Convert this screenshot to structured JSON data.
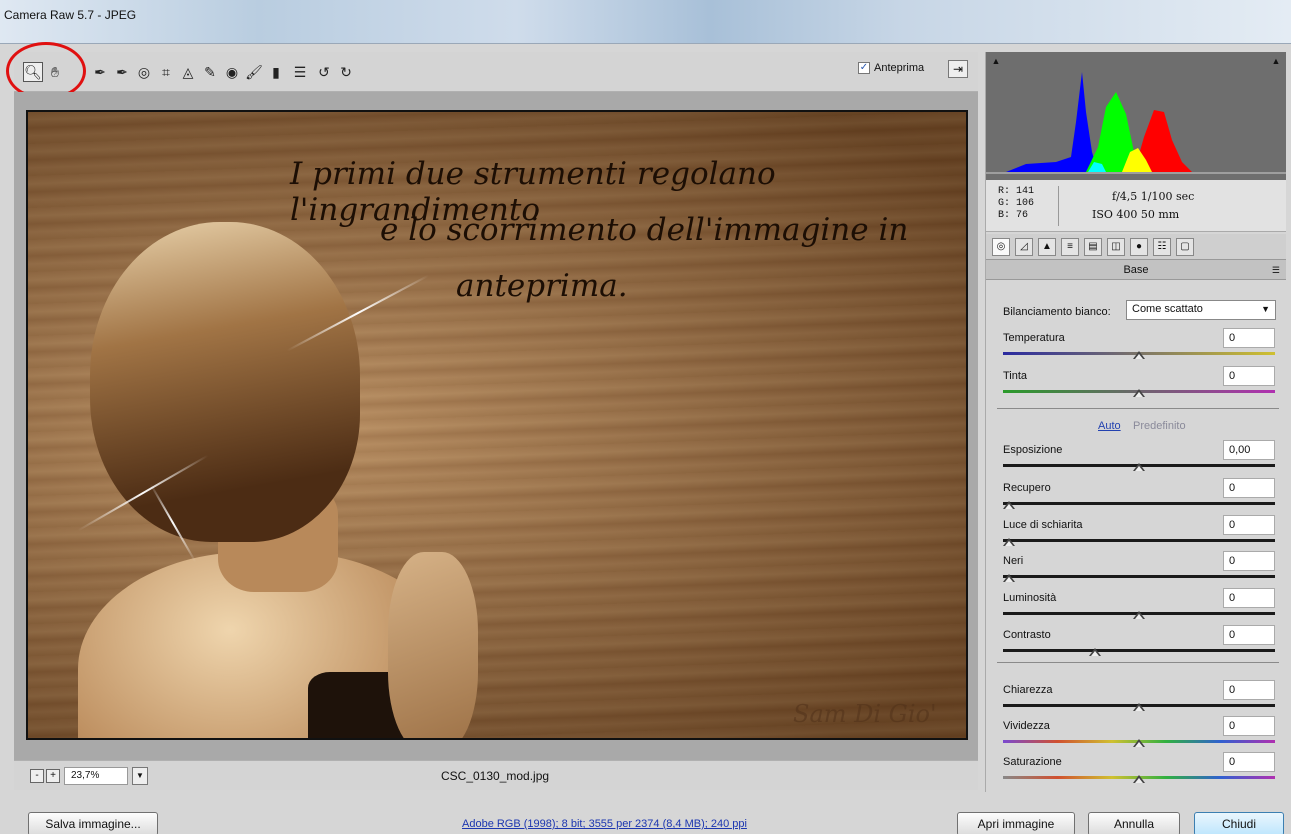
{
  "window": {
    "title": "Camera Raw 5.7  -  JPEG"
  },
  "toolbar": {
    "tools": [
      {
        "icon": "zoom-icon",
        "glyph": "🔍︎"
      },
      {
        "icon": "hand-icon",
        "glyph": "✋︎"
      },
      {
        "icon": "white-balance-icon",
        "glyph": "✒"
      },
      {
        "icon": "color-sampler-icon",
        "glyph": "✒"
      },
      {
        "icon": "target-adjust-icon",
        "glyph": "◎"
      },
      {
        "icon": "crop-icon",
        "glyph": "⌗"
      },
      {
        "icon": "straighten-icon",
        "glyph": "◬"
      },
      {
        "icon": "spot-removal-icon",
        "glyph": "✎"
      },
      {
        "icon": "red-eye-icon",
        "glyph": "◉"
      },
      {
        "icon": "adjustment-brush-icon",
        "glyph": "🖌︎"
      },
      {
        "icon": "graduated-filter-icon",
        "glyph": "▮"
      },
      {
        "icon": "preferences-icon",
        "glyph": "☰"
      },
      {
        "icon": "rotate-left-icon",
        "glyph": "↺"
      },
      {
        "icon": "rotate-right-icon",
        "glyph": "↻"
      }
    ],
    "preview_label": "Anteprima",
    "preview_checked": true
  },
  "preview": {
    "caption_line1": "I primi due strumenti regolano l'ingrandimento",
    "caption_line2": "e lo scorrimento dell'immagine in",
    "caption_line3": "anteprima.",
    "signature": "Sam Di Gio'"
  },
  "zoom": {
    "minus": "-",
    "plus": "+",
    "value": "23,7%",
    "filename": "CSC_0130_mod.jpg"
  },
  "info": {
    "r": "R:  141",
    "g": "G:  106",
    "b": "B:   76",
    "aperture_shutter": "f/4,5   1/100 sec",
    "iso_focal": "ISO 400   50 mm"
  },
  "panel": {
    "section_title": "Base",
    "wb_label": "Bilanciamento bianco:",
    "wb_value": "Come scattato",
    "auto": "Auto",
    "default": "Predefinito",
    "sliders": [
      {
        "label": "Temperatura",
        "value": "0",
        "level": 0.5
      },
      {
        "label": "Tinta",
        "value": "0",
        "level": 0.5
      },
      {
        "label": "Esposizione",
        "value": "0,00",
        "level": 0.5
      },
      {
        "label": "Recupero",
        "value": "0",
        "level": 0.0
      },
      {
        "label": "Luce di schiarita",
        "value": "0",
        "level": 0.0
      },
      {
        "label": "Neri",
        "value": "0",
        "level": 0.0
      },
      {
        "label": "Luminosità",
        "value": "0",
        "level": 0.5
      },
      {
        "label": "Contrasto",
        "value": "0",
        "level": 0.33
      },
      {
        "label": "Chiarezza",
        "value": "0",
        "level": 0.5
      },
      {
        "label": "Vividezza",
        "value": "0",
        "level": 0.5
      },
      {
        "label": "Saturazione",
        "value": "0",
        "level": 0.5
      }
    ]
  },
  "footer": {
    "save": "Salva immagine...",
    "workflow": "Adobe RGB (1998); 8 bit; 3555 per 2374 (8,4 MB); 240 ppi",
    "open": "Apri immagine",
    "cancel": "Annulla",
    "done": "Chiudi"
  }
}
